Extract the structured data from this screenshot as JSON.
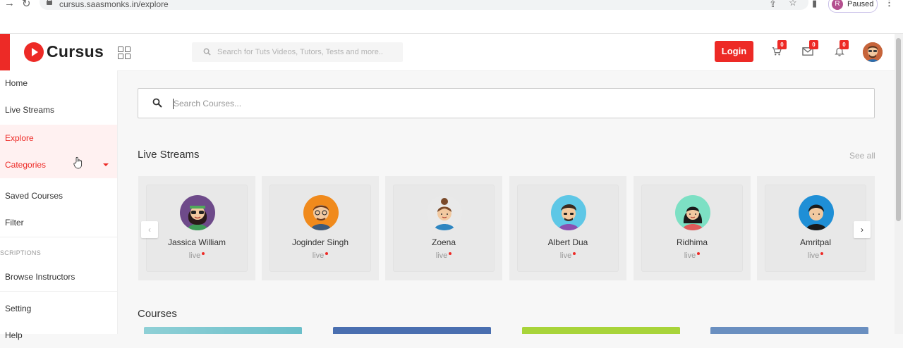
{
  "browser": {
    "url": "cursus.saasmonks.in/explore",
    "profile_initial": "R",
    "profile_status": "Paused"
  },
  "header": {
    "logo_text": "Cursus",
    "search_placeholder": "Search for Tuts Videos, Tutors, Tests and more..",
    "login_label": "Login",
    "cart_count": "0",
    "messages_count": "0",
    "notifications_count": "0"
  },
  "sidebar": {
    "items": [
      {
        "label": "Home"
      },
      {
        "label": "Live Streams"
      },
      {
        "label": "Explore"
      },
      {
        "label": "Categories"
      },
      {
        "label": "Saved Courses"
      },
      {
        "label": "Filter"
      },
      {
        "label": "Browse Instructors"
      },
      {
        "label": "Setting"
      },
      {
        "label": "Help"
      }
    ],
    "section_caption": "SCRIPTIONS"
  },
  "main": {
    "search_placeholder": "Search Courses...",
    "live_title": "Live Streams",
    "see_all": "See all",
    "courses_title": "Courses",
    "streams": [
      {
        "name": "Jassica William",
        "status": "live"
      },
      {
        "name": "Joginder Singh",
        "status": "live"
      },
      {
        "name": "Zoena",
        "status": "live"
      },
      {
        "name": "Albert Dua",
        "status": "live"
      },
      {
        "name": "Ridhima",
        "status": "live"
      },
      {
        "name": "Amritpal",
        "status": "live"
      }
    ],
    "arrow_prev": "‹",
    "arrow_next": "›"
  },
  "colors": {
    "accent": "#ed2a26",
    "active_bg": "#fff1f1"
  }
}
